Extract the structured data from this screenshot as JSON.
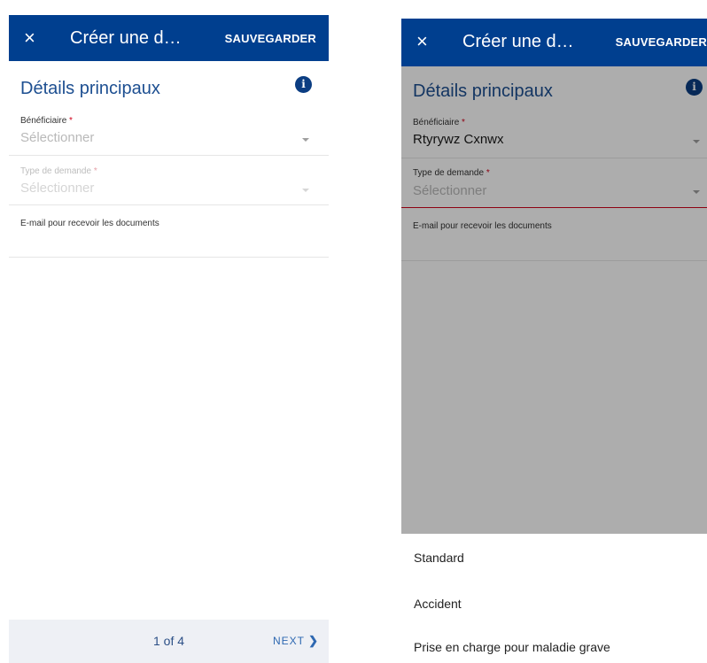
{
  "left": {
    "header": {
      "close_icon": "×",
      "title": "Créer une d…",
      "save_label": "SAUVEGARDER"
    },
    "section": {
      "title": "Détails principaux",
      "info_icon": "i"
    },
    "beneficiary": {
      "label": "Bénéficiaire",
      "required_mark": "*",
      "value": "Sélectionner"
    },
    "request_type": {
      "label": "Type de demande",
      "required_mark": "*",
      "value": "Sélectionner"
    },
    "email": {
      "label": "E-mail pour recevoir les documents"
    },
    "footer": {
      "pager": "1 of 4",
      "next_label": "NEXT",
      "next_chevron": "❯"
    }
  },
  "right": {
    "header": {
      "close_icon": "×",
      "title": "Créer une d…",
      "save_label": "SAUVEGARDER"
    },
    "section": {
      "title": "Détails principaux",
      "info_icon": "i"
    },
    "beneficiary": {
      "label": "Bénéficiaire",
      "required_mark": "*",
      "value": "Rtyrywz Cxnwx"
    },
    "request_type": {
      "label": "Type de demande",
      "required_mark": "*",
      "value": "Sélectionner"
    },
    "email": {
      "label": "E-mail pour recevoir les documents"
    },
    "dropdown_options": [
      "Standard",
      "Accident",
      "Prise en charge pour maladie grave"
    ]
  },
  "colors": {
    "header_bg": "#003f8f",
    "title_blue": "#1d4f91",
    "required_red": "#d0021b",
    "footer_bg": "#eef0f5",
    "link_blue": "#2e68b1"
  }
}
